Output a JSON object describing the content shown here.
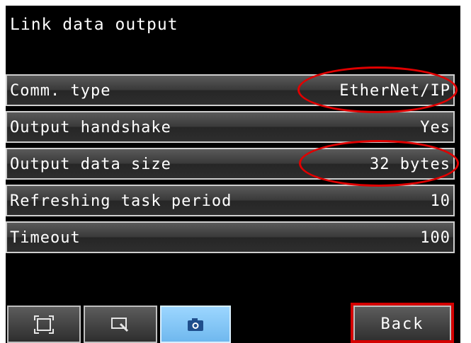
{
  "screen": {
    "title": "Link data output"
  },
  "settings": [
    {
      "label": "Comm. type",
      "value": "EtherNet/IP"
    },
    {
      "label": "Output handshake",
      "value": "Yes"
    },
    {
      "label": "Output data size",
      "value": "32 bytes"
    },
    {
      "label": "Refreshing task period",
      "value": "10"
    },
    {
      "label": "Timeout",
      "value": "100"
    }
  ],
  "toolbar": {
    "buttons": [
      {
        "icon": "fit-screen-icon",
        "active": false
      },
      {
        "icon": "zoom-icon",
        "active": false
      },
      {
        "icon": "camera-icon",
        "active": true
      }
    ],
    "back_label": "Back"
  },
  "colors": {
    "annotation": "#e00000",
    "active_button": "#8ccaf8",
    "background": "#000000"
  }
}
